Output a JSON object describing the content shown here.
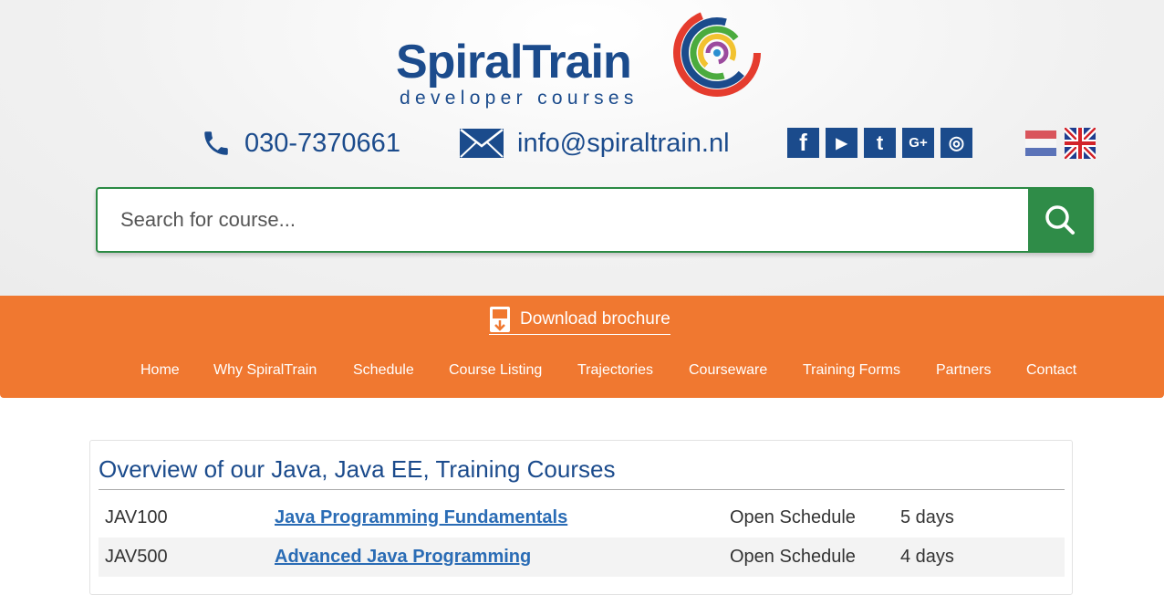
{
  "logo": {
    "name": "SpiralTrain",
    "tagline": "developer courses"
  },
  "contact": {
    "phone": "030-7370661",
    "email": "info@spiraltrain.nl"
  },
  "socials": [
    {
      "icon": "facebook-icon",
      "glyph": "f"
    },
    {
      "icon": "youtube-icon",
      "glyph": "▶"
    },
    {
      "icon": "twitter-icon",
      "glyph": "t"
    },
    {
      "icon": "google-plus-icon",
      "glyph": "G+"
    },
    {
      "icon": "instagram-icon",
      "glyph": "◎"
    }
  ],
  "languages": [
    "nl-flag-icon",
    "uk-flag-icon"
  ],
  "search": {
    "placeholder": "Search for course..."
  },
  "brochure": {
    "label": "Download brochure"
  },
  "nav": {
    "home": "Home",
    "why": "Why SpiralTrain",
    "schedule": "Schedule",
    "course_listing": "Course Listing",
    "trajectories": "Trajectories",
    "courseware": "Courseware",
    "training_forms": "Training Forms",
    "partners": "Partners",
    "contact": "Contact"
  },
  "overview": {
    "title": "Overview of our Java, Java EE, Training Courses",
    "rows": [
      {
        "code": "JAV100",
        "name": "Java Programming Fundamentals",
        "schedule": "Open Schedule",
        "duration": "5 days"
      },
      {
        "code": "JAV500",
        "name": "Advanced Java Programming",
        "schedule": "Open Schedule",
        "duration": "4 days"
      }
    ]
  },
  "colors": {
    "brand_blue": "#1b4b8c",
    "search_green": "#2f8c48",
    "nav_orange": "#f07830",
    "link_blue": "#2a6cb5"
  }
}
